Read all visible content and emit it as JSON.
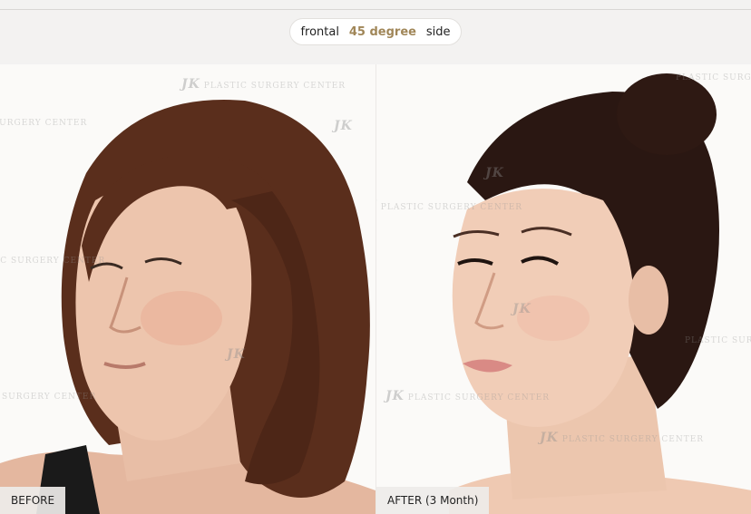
{
  "view_tabs": {
    "items": [
      {
        "label": "frontal"
      },
      {
        "label": "45 degree"
      },
      {
        "label": "side"
      }
    ],
    "selected": "45 degree"
  },
  "before": {
    "label": "BEFORE"
  },
  "after": {
    "label": "AFTER (3 Month)"
  },
  "watermark": {
    "logo": "JK",
    "text": "PLASTIC SURGERY CENTER"
  },
  "colors": {
    "accent": "#a08658",
    "hair_before": "#5a2e1c",
    "hair_after": "#2a1712",
    "skin": "#edc5ad"
  },
  "icons": [
    "watermark-logo-icon"
  ]
}
